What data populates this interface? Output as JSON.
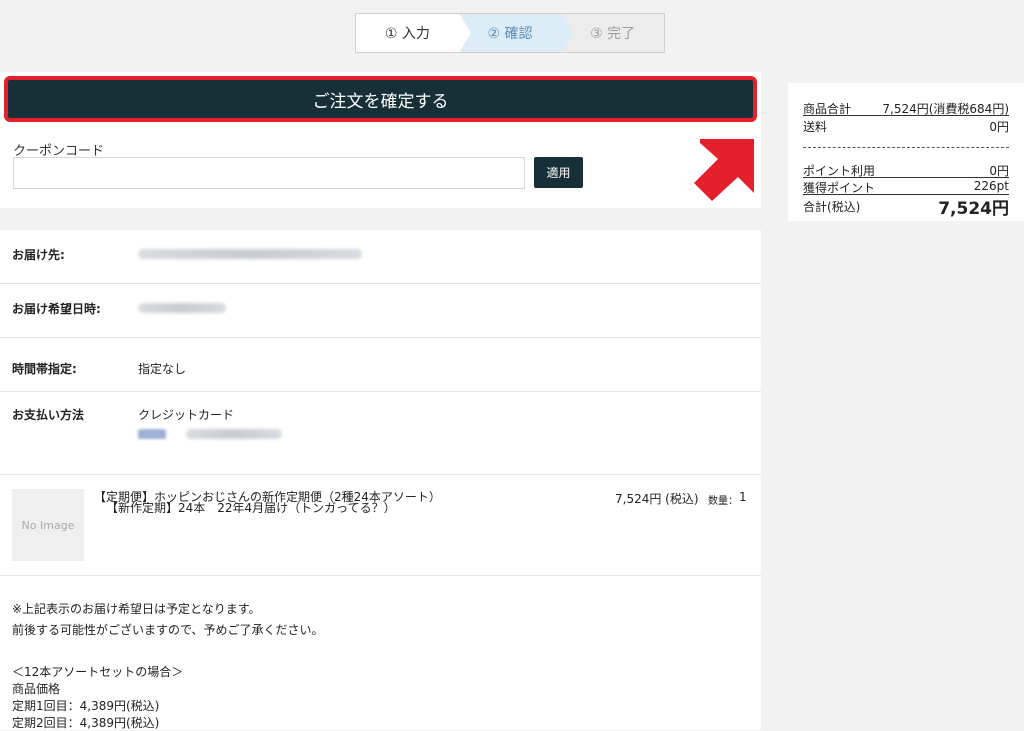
{
  "stepper": {
    "steps": [
      {
        "label": "① 入力"
      },
      {
        "label": "② 確認"
      },
      {
        "label": "③ 完了"
      }
    ]
  },
  "confirm": {
    "button_label": "ご注文を確定する",
    "coupon_label": "クーポンコード",
    "coupon_value": "",
    "apply_label": "適用"
  },
  "summary": {
    "subtotal_label": "商品合計",
    "subtotal_value": "7,524円(消費税684円)",
    "shipping_label": "送料",
    "shipping_value": "0円",
    "points_used_label": "ポイント利用",
    "points_used_value": "0円",
    "points_earned_label": "獲得ポイント",
    "points_earned_value": "226pt",
    "total_label": "合計(税込)",
    "total_value": "7,524円"
  },
  "details": {
    "address_label": "お届け先:",
    "delivery_date_label": "お届け希望日時:",
    "time_label": "時間帯指定:",
    "time_value": "指定なし",
    "payment_label": "お支払い方法",
    "payment_value": "クレジットカード"
  },
  "product": {
    "no_image": "No Image",
    "name": "【定期便】ホッピンおじさんの新作定期便（2種24本アソート）",
    "subtitle": "【新作定期】24本　22年4月届け（トンガってる？）",
    "price": "7,524円 (税込)",
    "qty_label": "数量：",
    "qty": "1"
  },
  "notes": {
    "line1": "※上記表示のお届け希望日は予定となります。",
    "line2": "前後する可能性がございますので、予めご了承ください。",
    "line3": "＜12本アソートセットの場合＞",
    "line4": "商品価格",
    "line5": "定期1回目：4,389円(税込)",
    "line6": "定期2回目：4,389円(税込)"
  },
  "colors": {
    "accent": "#173038",
    "highlight_red": "#e3202b",
    "step_active_bg": "#dcedf7"
  }
}
